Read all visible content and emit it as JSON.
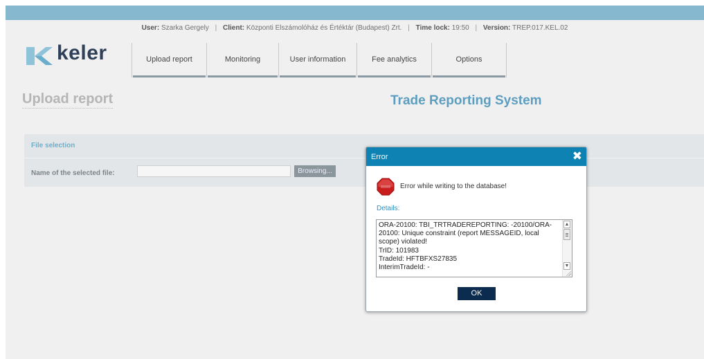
{
  "info_bar": {
    "user_label": "User:",
    "user_value": "Szarka Gergely",
    "client_label": "Client:",
    "client_value": "Központi Elszámolóház és Értéktár (Budapest) Zrt.",
    "timelock_label": "Time lock:",
    "timelock_value": "19:50",
    "version_label": "Version:",
    "version_value": "TREP.017.KEL.02",
    "separator": "|"
  },
  "logo": {
    "text": "keler",
    "icon": "keler-logo-icon"
  },
  "nav": {
    "items": [
      {
        "label": "Upload report"
      },
      {
        "label": "Monitoring"
      },
      {
        "label": "User information"
      },
      {
        "label": "Fee analytics"
      },
      {
        "label": "Options"
      }
    ]
  },
  "page": {
    "title": "Upload report",
    "system_title": "Trade Reporting System"
  },
  "file_panel": {
    "header": "File selection",
    "field_label": "Name of the selected file:",
    "field_value": "",
    "browse_label": "Browsing..."
  },
  "dialog": {
    "title": "Error",
    "close_icon": "close-icon",
    "message": "Error while writing to the database!",
    "details_label": "Details:",
    "details_lines": [
      "ORA-20100: TBI_TRTRADEREPORTING: -20100/ORA-20100: Unique constraint (report MESSAGEID, local scope) violated!",
      "TrID: 101983",
      "TradeId: HFTBFXS27835",
      "InterimTradeId: -"
    ],
    "ok_label": "OK"
  },
  "colors": {
    "accent": "#0f82b4",
    "top_bar": "#86b9d0",
    "ok_button": "#0b2c4f",
    "system_title": "#5d9ec0",
    "stop_icon": "#d32020"
  }
}
